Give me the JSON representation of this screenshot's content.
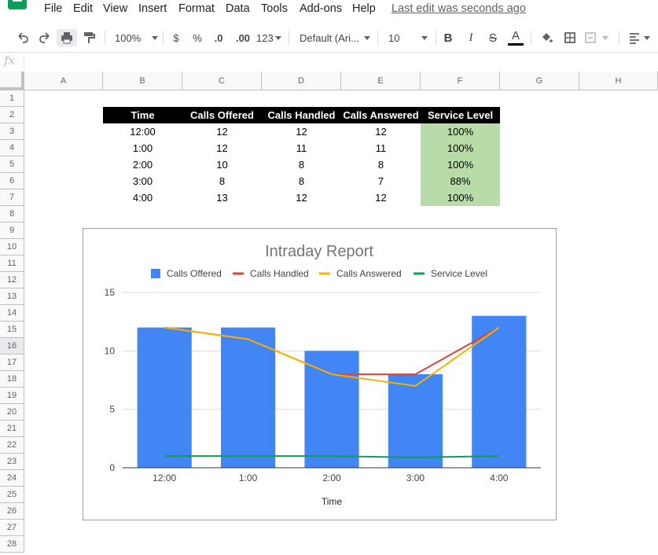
{
  "menubar": {
    "items": [
      "File",
      "Edit",
      "View",
      "Insert",
      "Format",
      "Data",
      "Tools",
      "Add-ons",
      "Help"
    ],
    "last_edit": "Last edit was seconds ago"
  },
  "toolbar": {
    "zoom": "100%",
    "currency": "$",
    "percent": "%",
    "decrease_decimal": ".0",
    "increase_decimal": ".00",
    "more_formats": "123",
    "font": "Default (Ari...",
    "font_size": "10",
    "bold": "B",
    "italic": "I",
    "strike": "S",
    "text_color": "A"
  },
  "formula_bar": {
    "fx": "fx",
    "value": ""
  },
  "columns": [
    "A",
    "B",
    "C",
    "D",
    "E",
    "F",
    "G",
    "H"
  ],
  "rows": [
    "1",
    "2",
    "3",
    "4",
    "5",
    "6",
    "7",
    "8",
    "9",
    "10",
    "11",
    "12",
    "13",
    "14",
    "15",
    "16",
    "17",
    "18",
    "19",
    "20",
    "21",
    "22",
    "23",
    "24",
    "25",
    "26",
    "27",
    "28"
  ],
  "table": {
    "headers": [
      "Time",
      "Calls Offered",
      "Calls Handled",
      "Calls Answered",
      "Service Level"
    ],
    "rows": [
      [
        "12:00",
        "12",
        "12",
        "12",
        "100%"
      ],
      [
        "1:00",
        "12",
        "11",
        "11",
        "100%"
      ],
      [
        "2:00",
        "10",
        "8",
        "8",
        "100%"
      ],
      [
        "3:00",
        "8",
        "8",
        "7",
        "88%"
      ],
      [
        "4:00",
        "13",
        "12",
        "12",
        "100%"
      ]
    ]
  },
  "chart_data": {
    "type": "bar",
    "title": "Intraday Report",
    "xlabel": "Time",
    "ylabel": "",
    "categories": [
      "12:00",
      "1:00",
      "2:00",
      "3:00",
      "4:00"
    ],
    "ylim": [
      0,
      15
    ],
    "yticks": [
      "0",
      "5",
      "10",
      "15"
    ],
    "grid": true,
    "legend": "top",
    "series": [
      {
        "name": "Calls Offered",
        "type": "bar",
        "color": "#4285f4",
        "values": [
          12,
          12,
          10,
          8,
          13
        ]
      },
      {
        "name": "Calls Handled",
        "type": "line",
        "color": "#db4437",
        "values": [
          12,
          11,
          8,
          8,
          12
        ]
      },
      {
        "name": "Calls Answered",
        "type": "line",
        "color": "#f4b400",
        "values": [
          12,
          11,
          8,
          7,
          12
        ]
      },
      {
        "name": "Service Level",
        "type": "line",
        "color": "#0f9d58",
        "values": [
          1,
          1,
          1,
          0.88,
          1
        ]
      }
    ]
  },
  "colors": {
    "header_bg": "#000000",
    "service_level_bg": "#b7dca8",
    "accent": "#0f9d58"
  }
}
